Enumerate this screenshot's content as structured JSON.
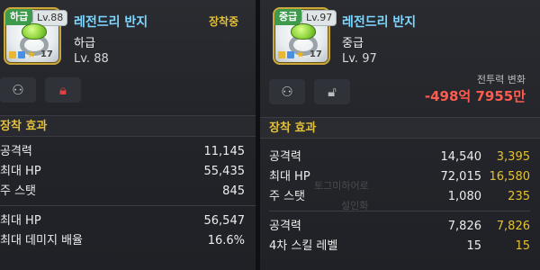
{
  "left": {
    "grade_tag": "하급",
    "level_tag": "Lv.88",
    "name": "레전드리 반지",
    "grade": "하급",
    "level": "Lv. 88",
    "equipped": "장착중",
    "stars": "17",
    "section_title": "장착 효과",
    "stats_a": [
      {
        "name": "공격력",
        "base": "11,145"
      },
      {
        "name": "최대 HP",
        "base": "55,435"
      },
      {
        "name": "주 스탯",
        "base": "845"
      }
    ],
    "stats_b": [
      {
        "name": "최대 HP",
        "base": "56,547"
      },
      {
        "name": "최대 데미지 배율",
        "base": "16.6%"
      }
    ]
  },
  "right": {
    "grade_tag": "중급",
    "level_tag": "Lv.97",
    "name": "레전드리 반지",
    "grade": "중급",
    "level": "Lv. 97",
    "stars": "17",
    "cp_label": "전투력 변화",
    "cp_value": "-498억 7955만",
    "section_title": "장착 효과",
    "stats_a": [
      {
        "name": "공격력",
        "base": "14,540",
        "bonus": "3,395"
      },
      {
        "name": "최대 HP",
        "base": "72,015",
        "bonus": "16,580"
      },
      {
        "name": "주 스탯",
        "base": "1,080",
        "bonus": "235"
      }
    ],
    "stats_b": [
      {
        "name": "공격력",
        "base": "7,826",
        "bonus": "7,826"
      },
      {
        "name": "4차 스킬 레벨",
        "base": "15",
        "bonus": "15"
      }
    ],
    "bg_text_1": "토그미하어로",
    "bg_text_2": "설인화"
  },
  "colors": {
    "name_blue": "#7ed7ff",
    "gold": "#e3c13a",
    "red": "#ff5b4f",
    "grade_green": "#3e9b4c"
  },
  "icons": {
    "share": "share-icon",
    "lock": "lock-icon",
    "unlock": "unlock-icon",
    "star": "star-icon"
  }
}
